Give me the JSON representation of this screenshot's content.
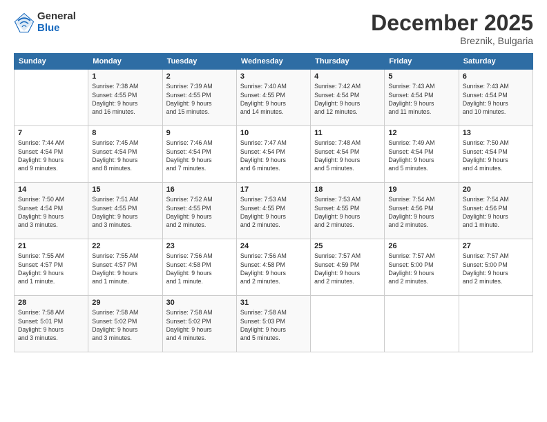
{
  "logo": {
    "general": "General",
    "blue": "Blue"
  },
  "title": "December 2025",
  "location": "Breznik, Bulgaria",
  "days_of_week": [
    "Sunday",
    "Monday",
    "Tuesday",
    "Wednesday",
    "Thursday",
    "Friday",
    "Saturday"
  ],
  "weeks": [
    [
      {
        "day": "",
        "info": ""
      },
      {
        "day": "1",
        "info": "Sunrise: 7:38 AM\nSunset: 4:55 PM\nDaylight: 9 hours\nand 16 minutes."
      },
      {
        "day": "2",
        "info": "Sunrise: 7:39 AM\nSunset: 4:55 PM\nDaylight: 9 hours\nand 15 minutes."
      },
      {
        "day": "3",
        "info": "Sunrise: 7:40 AM\nSunset: 4:55 PM\nDaylight: 9 hours\nand 14 minutes."
      },
      {
        "day": "4",
        "info": "Sunrise: 7:42 AM\nSunset: 4:54 PM\nDaylight: 9 hours\nand 12 minutes."
      },
      {
        "day": "5",
        "info": "Sunrise: 7:43 AM\nSunset: 4:54 PM\nDaylight: 9 hours\nand 11 minutes."
      },
      {
        "day": "6",
        "info": "Sunrise: 7:43 AM\nSunset: 4:54 PM\nDaylight: 9 hours\nand 10 minutes."
      }
    ],
    [
      {
        "day": "7",
        "info": "Sunrise: 7:44 AM\nSunset: 4:54 PM\nDaylight: 9 hours\nand 9 minutes."
      },
      {
        "day": "8",
        "info": "Sunrise: 7:45 AM\nSunset: 4:54 PM\nDaylight: 9 hours\nand 8 minutes."
      },
      {
        "day": "9",
        "info": "Sunrise: 7:46 AM\nSunset: 4:54 PM\nDaylight: 9 hours\nand 7 minutes."
      },
      {
        "day": "10",
        "info": "Sunrise: 7:47 AM\nSunset: 4:54 PM\nDaylight: 9 hours\nand 6 minutes."
      },
      {
        "day": "11",
        "info": "Sunrise: 7:48 AM\nSunset: 4:54 PM\nDaylight: 9 hours\nand 5 minutes."
      },
      {
        "day": "12",
        "info": "Sunrise: 7:49 AM\nSunset: 4:54 PM\nDaylight: 9 hours\nand 5 minutes."
      },
      {
        "day": "13",
        "info": "Sunrise: 7:50 AM\nSunset: 4:54 PM\nDaylight: 9 hours\nand 4 minutes."
      }
    ],
    [
      {
        "day": "14",
        "info": "Sunrise: 7:50 AM\nSunset: 4:54 PM\nDaylight: 9 hours\nand 3 minutes."
      },
      {
        "day": "15",
        "info": "Sunrise: 7:51 AM\nSunset: 4:55 PM\nDaylight: 9 hours\nand 3 minutes."
      },
      {
        "day": "16",
        "info": "Sunrise: 7:52 AM\nSunset: 4:55 PM\nDaylight: 9 hours\nand 2 minutes."
      },
      {
        "day": "17",
        "info": "Sunrise: 7:53 AM\nSunset: 4:55 PM\nDaylight: 9 hours\nand 2 minutes."
      },
      {
        "day": "18",
        "info": "Sunrise: 7:53 AM\nSunset: 4:55 PM\nDaylight: 9 hours\nand 2 minutes."
      },
      {
        "day": "19",
        "info": "Sunrise: 7:54 AM\nSunset: 4:56 PM\nDaylight: 9 hours\nand 2 minutes."
      },
      {
        "day": "20",
        "info": "Sunrise: 7:54 AM\nSunset: 4:56 PM\nDaylight: 9 hours\nand 1 minute."
      }
    ],
    [
      {
        "day": "21",
        "info": "Sunrise: 7:55 AM\nSunset: 4:57 PM\nDaylight: 9 hours\nand 1 minute."
      },
      {
        "day": "22",
        "info": "Sunrise: 7:55 AM\nSunset: 4:57 PM\nDaylight: 9 hours\nand 1 minute."
      },
      {
        "day": "23",
        "info": "Sunrise: 7:56 AM\nSunset: 4:58 PM\nDaylight: 9 hours\nand 1 minute."
      },
      {
        "day": "24",
        "info": "Sunrise: 7:56 AM\nSunset: 4:58 PM\nDaylight: 9 hours\nand 2 minutes."
      },
      {
        "day": "25",
        "info": "Sunrise: 7:57 AM\nSunset: 4:59 PM\nDaylight: 9 hours\nand 2 minutes."
      },
      {
        "day": "26",
        "info": "Sunrise: 7:57 AM\nSunset: 5:00 PM\nDaylight: 9 hours\nand 2 minutes."
      },
      {
        "day": "27",
        "info": "Sunrise: 7:57 AM\nSunset: 5:00 PM\nDaylight: 9 hours\nand 2 minutes."
      }
    ],
    [
      {
        "day": "28",
        "info": "Sunrise: 7:58 AM\nSunset: 5:01 PM\nDaylight: 9 hours\nand 3 minutes."
      },
      {
        "day": "29",
        "info": "Sunrise: 7:58 AM\nSunset: 5:02 PM\nDaylight: 9 hours\nand 3 minutes."
      },
      {
        "day": "30",
        "info": "Sunrise: 7:58 AM\nSunset: 5:02 PM\nDaylight: 9 hours\nand 4 minutes."
      },
      {
        "day": "31",
        "info": "Sunrise: 7:58 AM\nSunset: 5:03 PM\nDaylight: 9 hours\nand 5 minutes."
      },
      {
        "day": "",
        "info": ""
      },
      {
        "day": "",
        "info": ""
      },
      {
        "day": "",
        "info": ""
      }
    ]
  ]
}
